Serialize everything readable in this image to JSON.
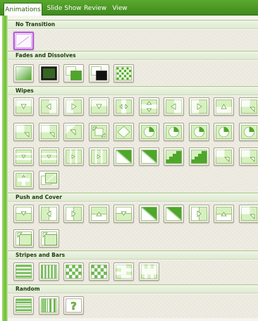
{
  "ribbon": {
    "tabs": [
      {
        "label": "Animations",
        "active": true
      },
      {
        "label": "Slide Show",
        "active": false
      },
      {
        "label": "Review",
        "active": false
      },
      {
        "label": "View",
        "active": false
      }
    ]
  },
  "colors": {
    "accent_green": "#5aa82e",
    "selection": "#b85cd6",
    "slide_light": "#d7f0bf",
    "slide_dark": "#4ea62a"
  },
  "sections": [
    {
      "id": "no-transition",
      "title": "No Transition",
      "items": [
        {
          "name": "no-transition",
          "icon": "blank",
          "selected": true
        }
      ]
    },
    {
      "id": "fades",
      "title": "Fades and Dissolves",
      "items": [
        {
          "name": "fade-smoothly",
          "icon": "fade-smooth"
        },
        {
          "name": "fade-through-black",
          "icon": "fade-black"
        },
        {
          "name": "cut",
          "icon": "fade-cut"
        },
        {
          "name": "cut-through-black",
          "icon": "cut-black"
        },
        {
          "name": "dissolve",
          "icon": "dissolve"
        }
      ]
    },
    {
      "id": "wipes",
      "title": "Wipes",
      "items": [
        {
          "name": "wipe-down",
          "icon": "arrow-down"
        },
        {
          "name": "wipe-left",
          "icon": "arrow-left"
        },
        {
          "name": "wipe-right",
          "icon": "arrow-right"
        },
        {
          "name": "wipe-up",
          "icon": "arrow-down"
        },
        {
          "name": "split-vertical-out",
          "icon": "split-v"
        },
        {
          "name": "split-horizontal-in",
          "icon": "split-h"
        },
        {
          "name": "strips-left-down",
          "icon": "arrow-left"
        },
        {
          "name": "strips-right-down",
          "icon": "arrow-right"
        },
        {
          "name": "strips-left-up",
          "icon": "arrow-up"
        },
        {
          "name": "strips-right-up",
          "icon": "corner"
        },
        {
          "name": "box-in",
          "icon": "corner"
        },
        {
          "name": "box-out",
          "icon": "corner"
        },
        {
          "name": "shape-circle",
          "icon": "arrow-diag"
        },
        {
          "name": "shape-diamond",
          "icon": "box"
        },
        {
          "name": "shape-plus",
          "icon": "diamond"
        },
        {
          "name": "wheel-1-spoke",
          "icon": "circle"
        },
        {
          "name": "wheel-2-spokes",
          "icon": "circle"
        },
        {
          "name": "wheel-3-spokes",
          "icon": "circle"
        },
        {
          "name": "wheel-4-spokes",
          "icon": "circle"
        },
        {
          "name": "wheel-8-spokes",
          "icon": "circle"
        },
        {
          "name": "wedge",
          "icon": "bars-h"
        },
        {
          "name": "uncover-down",
          "icon": "bars-h"
        },
        {
          "name": "uncover-left",
          "icon": "bars-v"
        },
        {
          "name": "uncover-right",
          "icon": "bars-v"
        },
        {
          "name": "uncover-up",
          "icon": "diag"
        },
        {
          "name": "uncover-left-down",
          "icon": "diag"
        },
        {
          "name": "uncover-left-up",
          "icon": "stairs"
        },
        {
          "name": "uncover-right-down",
          "icon": "stairs"
        },
        {
          "name": "uncover-right-up",
          "icon": "corner"
        },
        {
          "name": "shape-square",
          "icon": "corner"
        },
        {
          "name": "newsflash",
          "icon": "plus"
        },
        {
          "name": "zoom-out",
          "icon": "zoom"
        }
      ]
    },
    {
      "id": "push-cover",
      "title": "Push and Cover",
      "items": [
        {
          "name": "push-down",
          "icon": "push-down"
        },
        {
          "name": "push-left",
          "icon": "push-left"
        },
        {
          "name": "push-right",
          "icon": "push-right"
        },
        {
          "name": "push-up",
          "icon": "push-up"
        },
        {
          "name": "cover-down",
          "icon": "push-down"
        },
        {
          "name": "cover-left",
          "icon": "diag"
        },
        {
          "name": "cover-right",
          "icon": "diag"
        },
        {
          "name": "cover-up",
          "icon": "push-right"
        },
        {
          "name": "cover-left-down",
          "icon": "push-up"
        },
        {
          "name": "cover-left-up",
          "icon": "corner"
        },
        {
          "name": "cover-right-down",
          "icon": "push-diag"
        },
        {
          "name": "cover-right-up",
          "icon": "push-diag"
        }
      ]
    },
    {
      "id": "stripes",
      "title": "Stripes and Bars",
      "items": [
        {
          "name": "blinds-horizontal",
          "icon": "blinds-h"
        },
        {
          "name": "blinds-vertical",
          "icon": "blinds-v"
        },
        {
          "name": "checkerboard-across",
          "icon": "checker"
        },
        {
          "name": "checkerboard-down",
          "icon": "checker"
        },
        {
          "name": "comb-horizontal",
          "icon": "comb-h"
        },
        {
          "name": "comb-vertical",
          "icon": "comb-v"
        }
      ]
    },
    {
      "id": "random",
      "title": "Random",
      "items": [
        {
          "name": "random-bars-horizontal",
          "icon": "random-h"
        },
        {
          "name": "random-bars-vertical",
          "icon": "random-v"
        },
        {
          "name": "random-transition",
          "icon": "question"
        }
      ]
    }
  ]
}
